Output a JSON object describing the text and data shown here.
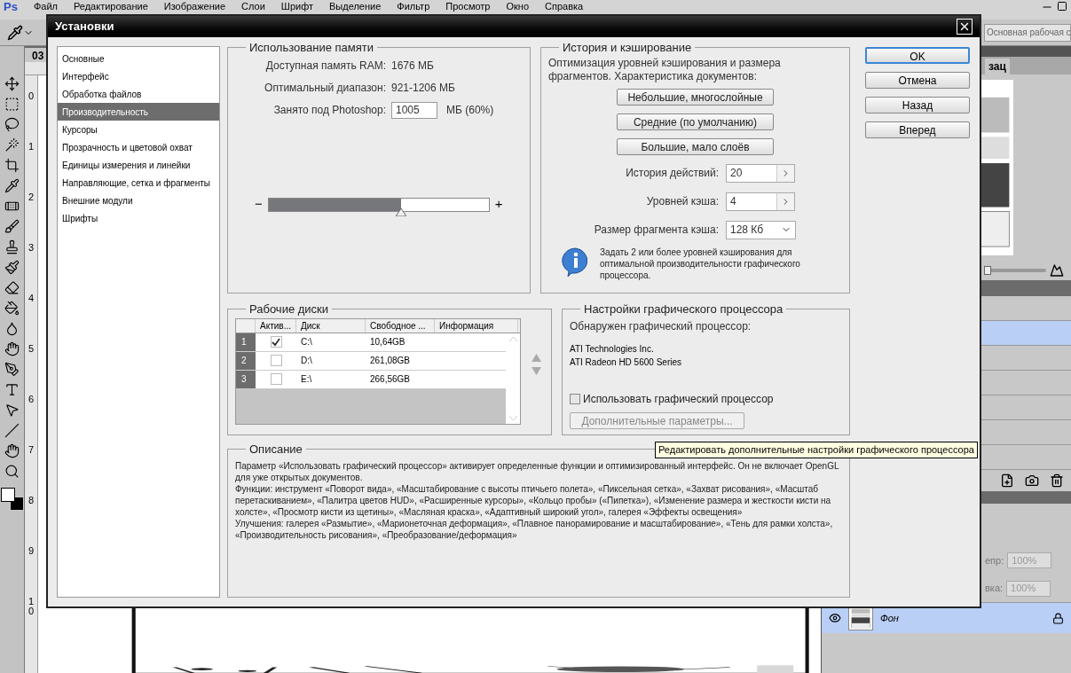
{
  "app": {
    "logo": "Ps",
    "menu": [
      "Файл",
      "Редактирование",
      "Изображение",
      "Слои",
      "Шрифт",
      "Выделение",
      "Фильтр",
      "Просмотр",
      "Окно",
      "Справка"
    ],
    "workspace": "Основная рабочая с",
    "doc_tab": "03",
    "ruler_marks": [
      "0",
      "1",
      "2",
      "3",
      "4",
      "5",
      "6",
      "7",
      "8",
      "9",
      "10"
    ],
    "panel_tab": "зац",
    "zoom": {
      "level": 0.05
    },
    "layer_rows": [
      {
        "selected": false
      },
      {
        "selected": true
      },
      {
        "selected": false
      },
      {
        "selected": false
      },
      {
        "selected": false
      },
      {
        "selected": false
      },
      {
        "selected": false
      }
    ],
    "opacity_label": "епр:",
    "opacity": "100%",
    "fill_label": "вка:",
    "fill": "100%",
    "layer": {
      "name": "Фон",
      "selected": true,
      "locked": true
    }
  },
  "dialog": {
    "title": "Установки",
    "categories": [
      {
        "label": "Основные",
        "selected": false
      },
      {
        "label": "Интерфейс",
        "selected": false
      },
      {
        "label": "Обработка файлов",
        "selected": false
      },
      {
        "label": "Производительность",
        "selected": true
      },
      {
        "label": "Курсоры",
        "selected": false
      },
      {
        "label": "Прозрачность и цветовой охват",
        "selected": false
      },
      {
        "label": "Единицы измерения и линейки",
        "selected": false
      },
      {
        "label": "Направляющие, сетка и фрагменты",
        "selected": false
      },
      {
        "label": "Внешние модули",
        "selected": false
      },
      {
        "label": "Шрифты",
        "selected": false
      }
    ],
    "memory": {
      "title": "Использование памяти",
      "rows": [
        {
          "label": "Доступная память RAM:",
          "value": "1676 МБ"
        },
        {
          "label": "Оптимальный диапазон:",
          "value": "921-1206 МБ"
        }
      ],
      "field_label": "Занято под Photoshop:",
      "field_value": "1005",
      "unit": "МБ (60%)",
      "minus": "−",
      "plus": "+",
      "level": 0.6
    },
    "history": {
      "title": "История и кэширование",
      "description": "Оптимизация уровней кэширования и размера фрагментов. Характеристика документов:",
      "presets": [
        "Небольшие, многослойные",
        "Средние (по умолчанию)",
        "Большие, мало слоёв"
      ],
      "fields": [
        {
          "kind": "stepper",
          "label": "История действий:",
          "value": "20"
        },
        {
          "kind": "stepper",
          "label": "Уровней кэша:",
          "value": "4"
        },
        {
          "kind": "dropdown",
          "label": "Размер фрагмента кэша:",
          "value": "128 Кб"
        }
      ],
      "note": "Задать 2 или более уровней кэширования для оптимальной производительности графического процессора."
    },
    "scratch": {
      "title": "Рабочие диски",
      "columns": [
        "Актив...",
        "Диск",
        "Свободное ...",
        "Информация"
      ],
      "rows": [
        {
          "index": "1",
          "active": true,
          "disk": "C:\\",
          "free": "10,64GB"
        },
        {
          "index": "2",
          "active": false,
          "disk": "D:\\",
          "free": "261,08GB"
        },
        {
          "index": "3",
          "active": false,
          "disk": "E:\\",
          "free": "266,56GB"
        }
      ]
    },
    "gpu": {
      "title": "Настройки графического процессора",
      "detected": "Обнаружен графический процессор:",
      "vendor": "ATI Technologies Inc.",
      "model": "ATI Radeon HD 5600 Series",
      "use_gpu": {
        "label": "Использовать графический процессор",
        "checked": false
      },
      "advanced": {
        "label": "Дополнительные параметры...",
        "disabled": true
      }
    },
    "tooltip": "Редактировать дополнительные настройки графического процессора",
    "description": {
      "title": "Описание",
      "paragraphs": [
        "Параметр «Использовать графический процессор» активирует определенные функции и оптимизированный интерфейс. Он не включает OpenGL для уже открытых документов.",
        "Функции: инструмент «Поворот вида», «Масштабирование с высоты птичьего полета», «Пиксельная сетка», «Захват рисования», «Масштаб перетаскиванием», «Палитра цветов HUD», «Расширенные курсоры», «Кольцо пробы» («Пипетка»), «Изменение размера и жесткости кисти на холсте», «Просмотр кисти из щетины», «Масляная краска», «Адаптивный широкий угол», галерея «Эффекты освещения»",
        "Улучшения: галерея «Размытие», «Марионеточная деформация», «Плавное панорамирование и масштабирование», «Тень для рамки холста», «Производительность рисования», «Преобразование/деформация»"
      ]
    },
    "buttons": [
      {
        "label": "OK",
        "default": true
      },
      {
        "label": "Отмена",
        "default": false
      },
      {
        "label": "Назад",
        "default": false
      },
      {
        "label": "Вперед",
        "default": false
      }
    ]
  }
}
